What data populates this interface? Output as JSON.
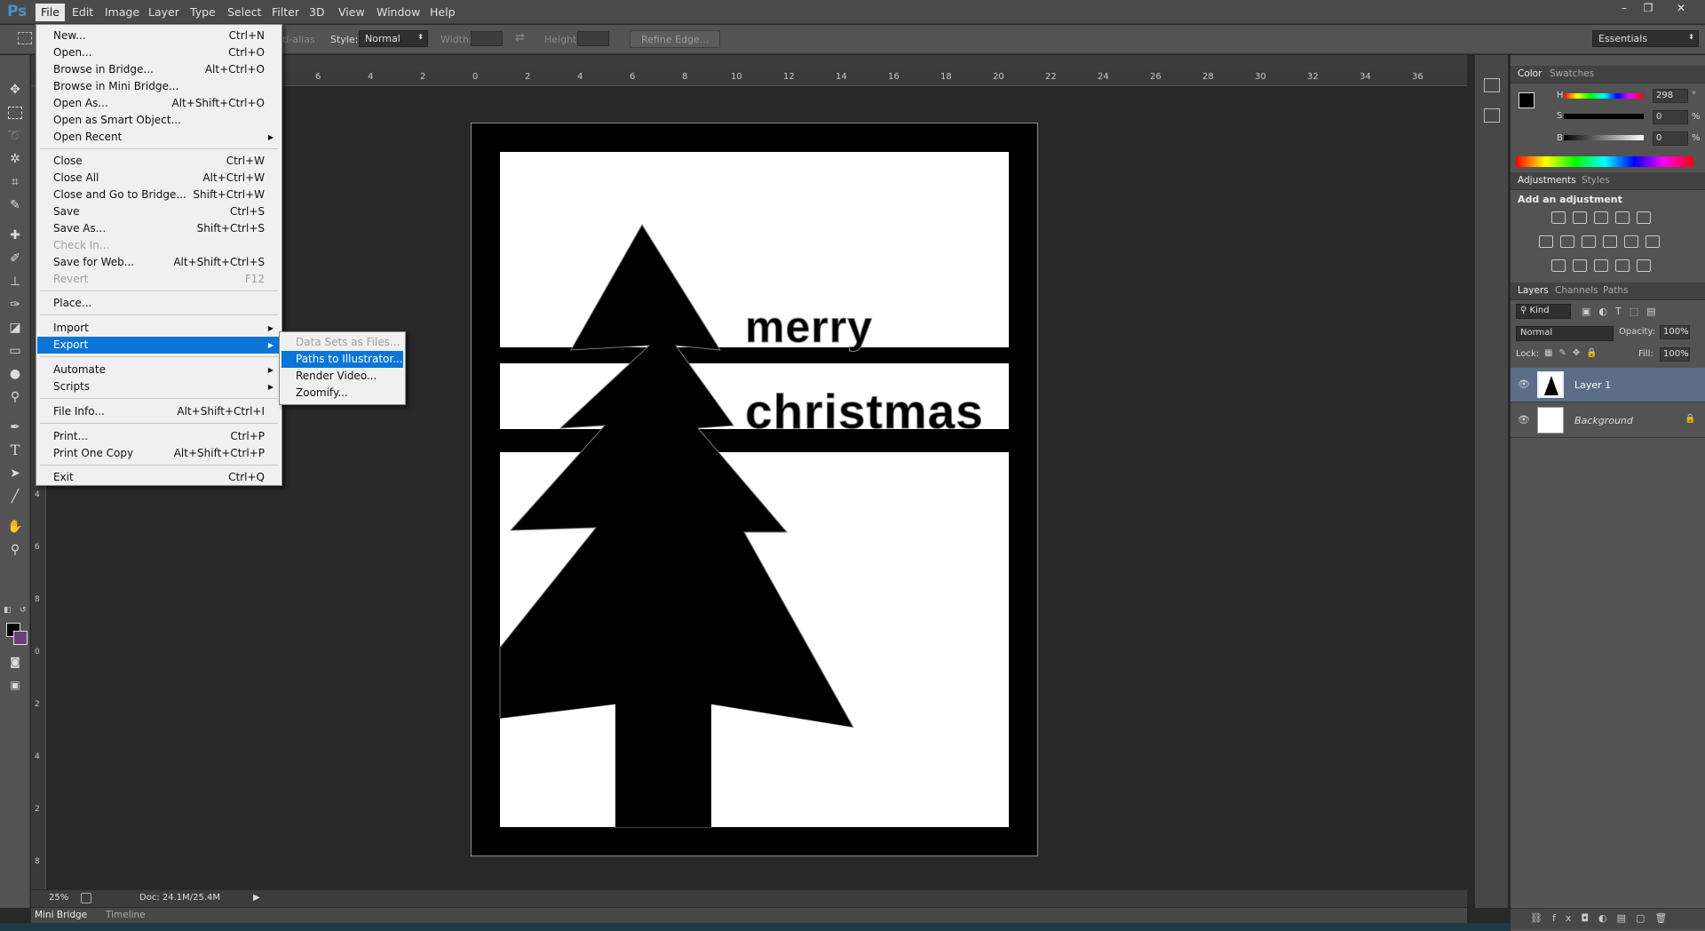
{
  "app": {
    "logo": "Ps"
  },
  "menubar": {
    "items": [
      "File",
      "Edit",
      "Image",
      "Layer",
      "Type",
      "Select",
      "Filter",
      "3D",
      "View",
      "Window",
      "Help"
    ],
    "active": "File",
    "window_controls": [
      "–",
      "❐",
      "✕"
    ]
  },
  "options": {
    "anti_alias": "ti-alias",
    "style_label": "Style:",
    "style_value": "Normal",
    "width_label": "Width:",
    "height_label": "Height:",
    "refine_edge": "Refine Edge...",
    "workspace": "Essentials"
  },
  "ruler": {
    "h_ticks": [
      "6",
      "4",
      "2",
      "0",
      "2",
      "4",
      "6",
      "8",
      "10",
      "12",
      "14",
      "16",
      "18",
      "20",
      "22",
      "24",
      "26",
      "28",
      "30",
      "32",
      "34",
      "36"
    ],
    "v_ticks": [
      "4",
      "6",
      "8",
      "0",
      "2",
      "4",
      "2",
      "8"
    ]
  },
  "artwork": {
    "line1": "merry",
    "line2": "christmas"
  },
  "file_menu": {
    "items": [
      {
        "label": "New...",
        "shortcut": "Ctrl+N"
      },
      {
        "label": "Open...",
        "shortcut": "Ctrl+O"
      },
      {
        "label": "Browse in Bridge...",
        "shortcut": "Alt+Ctrl+O"
      },
      {
        "label": "Browse in Mini Bridge...",
        "shortcut": ""
      },
      {
        "label": "Open As...",
        "shortcut": "Alt+Shift+Ctrl+O"
      },
      {
        "label": "Open as Smart Object...",
        "shortcut": ""
      },
      {
        "label": "Open Recent",
        "shortcut": "",
        "submenu": true
      },
      {
        "label": "Close",
        "shortcut": "Ctrl+W"
      },
      {
        "label": "Close All",
        "shortcut": "Alt+Ctrl+W"
      },
      {
        "label": "Close and Go to Bridge...",
        "shortcut": "Shift+Ctrl+W"
      },
      {
        "label": "Save",
        "shortcut": "Ctrl+S"
      },
      {
        "label": "Save As...",
        "shortcut": "Shift+Ctrl+S"
      },
      {
        "label": "Check In...",
        "shortcut": "",
        "disabled": true
      },
      {
        "label": "Save for Web...",
        "shortcut": "Alt+Shift+Ctrl+S"
      },
      {
        "label": "Revert",
        "shortcut": "F12",
        "disabled": true
      },
      {
        "label": "Place...",
        "shortcut": ""
      },
      {
        "label": "Import",
        "shortcut": "",
        "submenu": true
      },
      {
        "label": "Export",
        "shortcut": "",
        "submenu": true,
        "highlight": true
      },
      {
        "label": "Automate",
        "shortcut": "",
        "submenu": true
      },
      {
        "label": "Scripts",
        "shortcut": "",
        "submenu": true
      },
      {
        "label": "File Info...",
        "shortcut": "Alt+Shift+Ctrl+I"
      },
      {
        "label": "Print...",
        "shortcut": "Ctrl+P"
      },
      {
        "label": "Print One Copy",
        "shortcut": "Alt+Shift+Ctrl+P"
      },
      {
        "label": "Exit",
        "shortcut": "Ctrl+Q"
      }
    ]
  },
  "export_submenu": {
    "items": [
      {
        "label": "Data Sets as Files...",
        "disabled": true
      },
      {
        "label": "Paths to Illustrator...",
        "highlight": true
      },
      {
        "label": "Render Video..."
      },
      {
        "label": "Zoomify..."
      }
    ]
  },
  "status": {
    "zoom": "25%",
    "doc": "Doc: 24.1M/25.4M"
  },
  "bottom_tabs": [
    "Mini Bridge",
    "Timeline"
  ],
  "color_panel": {
    "tabs": [
      "Color",
      "Swatches"
    ],
    "h_label": "H",
    "s_label": "S",
    "b_label": "B",
    "h_value": "298",
    "s_value": "0",
    "b_value": "0",
    "h_unit": "°",
    "s_unit": "%",
    "b_unit": "%"
  },
  "adjustments_panel": {
    "tabs": [
      "Adjustments",
      "Styles"
    ],
    "heading": "Add an adjustment"
  },
  "layers_panel": {
    "tabs": [
      "Layers",
      "Channels",
      "Paths"
    ],
    "kind": "Kind",
    "blend_mode": "Normal",
    "opacity_label": "Opacity:",
    "opacity_value": "100%",
    "lock_label": "Lock:",
    "fill_label": "Fill:",
    "fill_value": "100%",
    "layers": [
      {
        "name": "Layer 1",
        "selected": true
      },
      {
        "name": "Background",
        "selected": false
      }
    ]
  }
}
